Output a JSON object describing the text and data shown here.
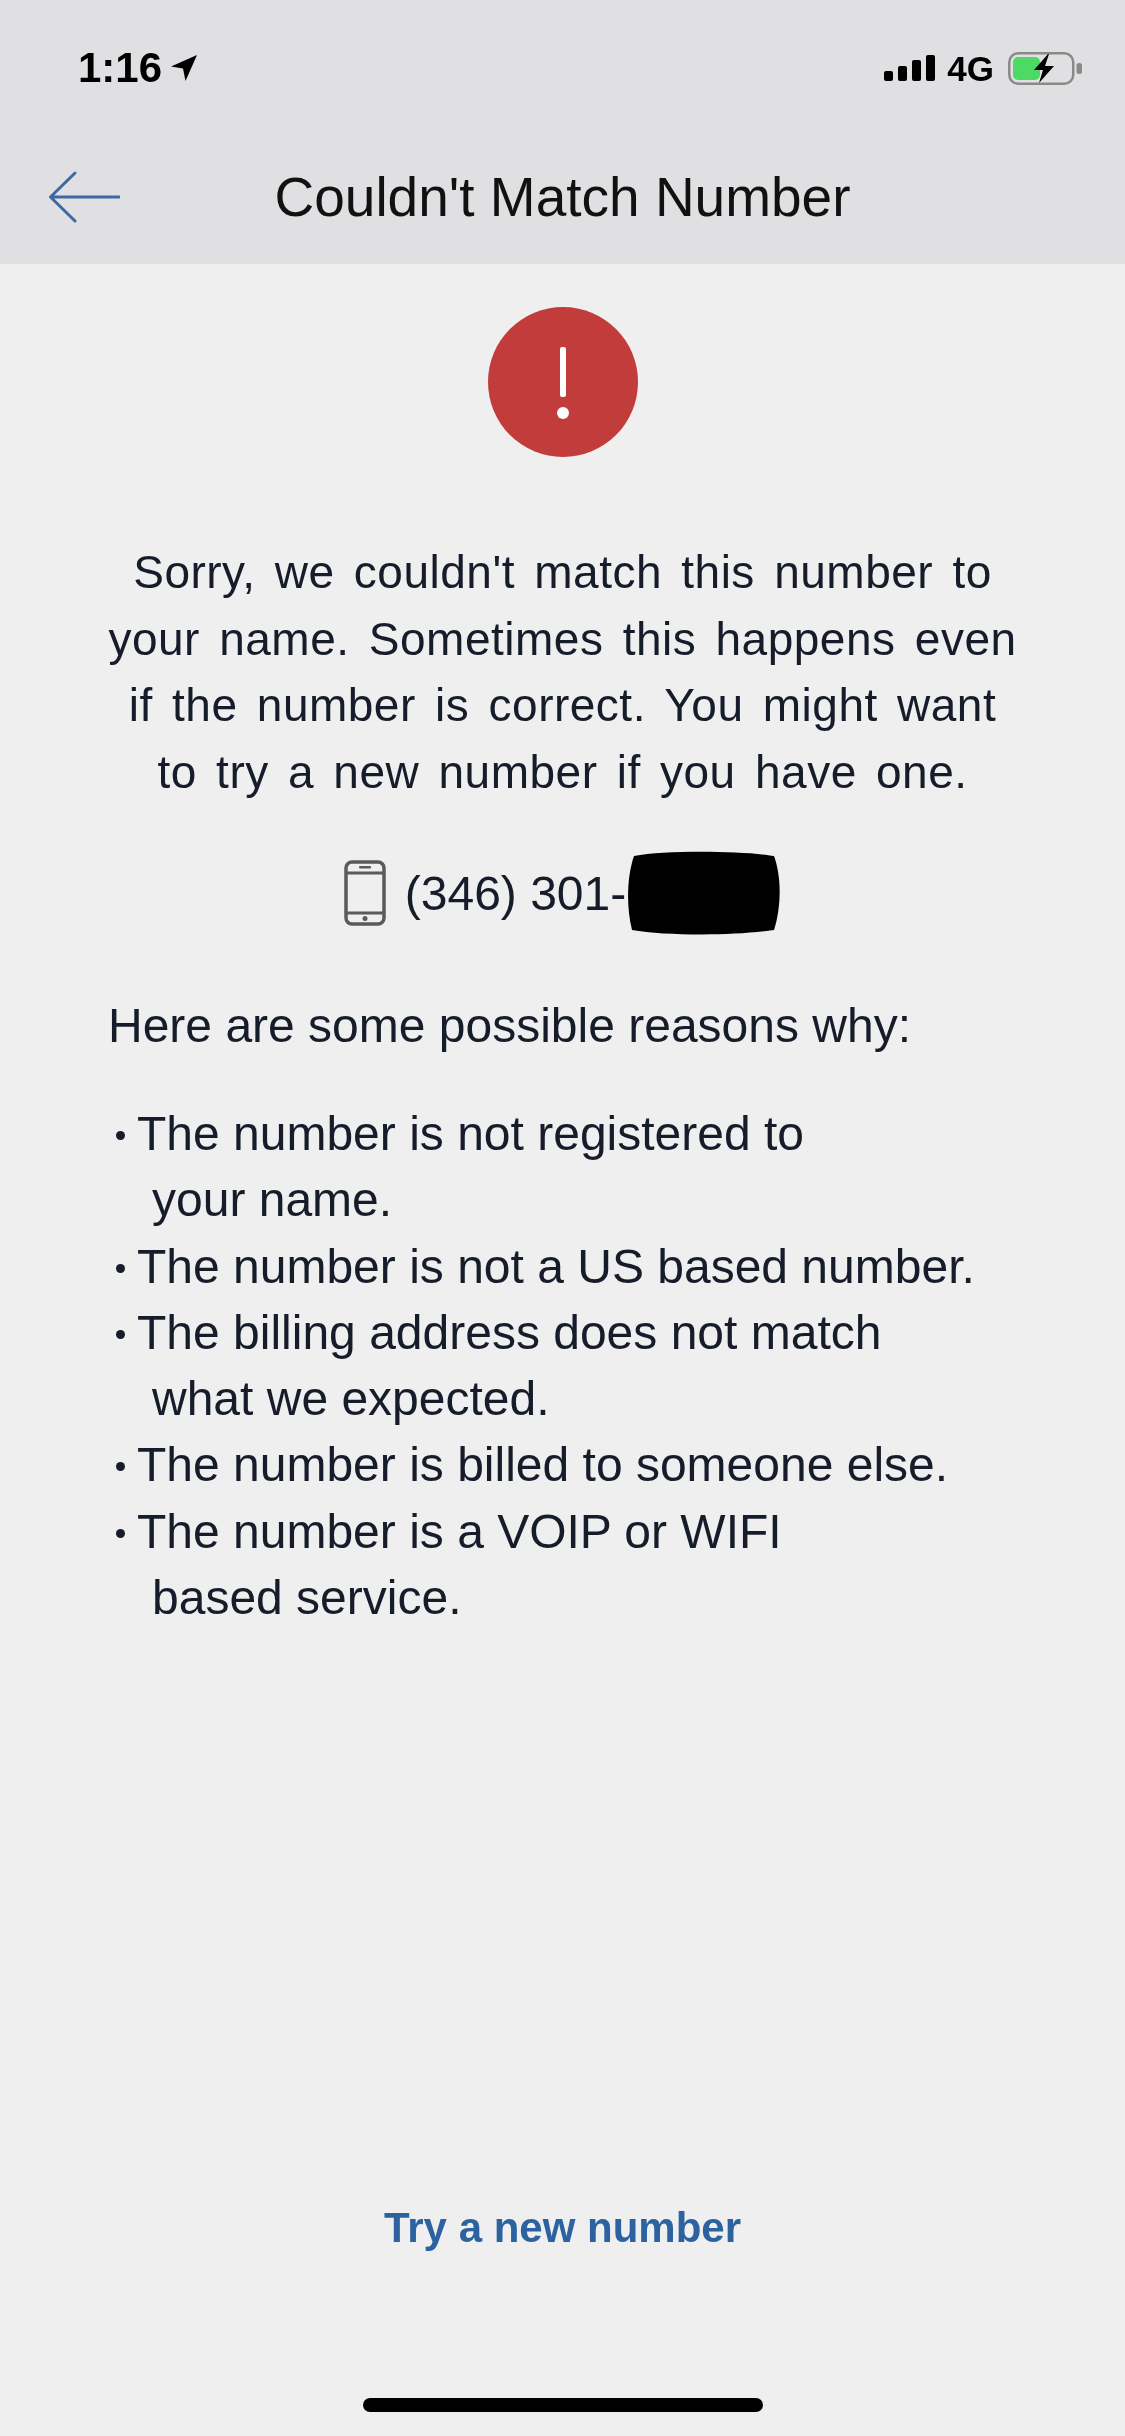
{
  "status_bar": {
    "time": "1:16",
    "network": "4G"
  },
  "header": {
    "title": "Couldn't Match Number"
  },
  "message": "Sorry, we couldn't match this number to your name. Sometimes this happens even if the number is correct. You might want to try a new number if you have one.",
  "phone": {
    "number": "(346) 301-"
  },
  "reasons": {
    "intro": "Here are some possible reasons why:",
    "items": [
      "The number is not registered to\nyour name.",
      "The number is not a US based number.",
      "The billing address does not match\nwhat we expected.",
      "The number is billed to someone else.",
      "The number is a VOIP or WIFI\nbased service."
    ]
  },
  "action": {
    "label": "Try a new number"
  }
}
